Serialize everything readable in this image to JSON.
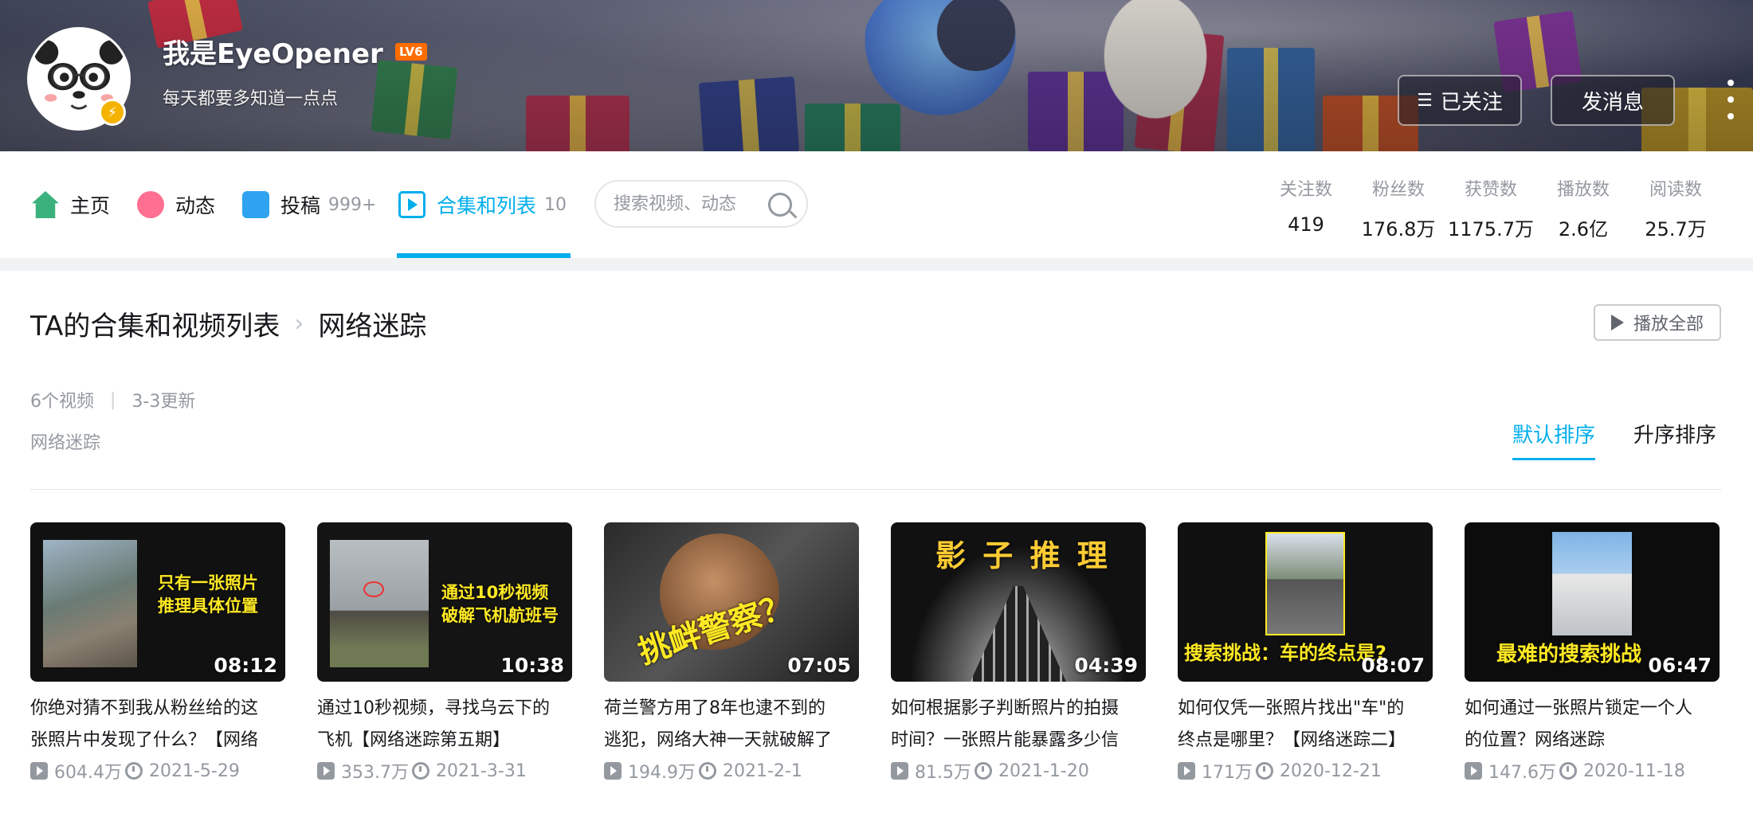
{
  "header": {
    "username": "我是EyeOpener",
    "level": "LV6",
    "signature": "每天都要多知道一点点",
    "follow_button": "已关注",
    "message_button": "发消息"
  },
  "nav": {
    "tabs": [
      {
        "label": "主页",
        "count": ""
      },
      {
        "label": "动态",
        "count": ""
      },
      {
        "label": "投稿",
        "count": "999+"
      },
      {
        "label": "合集和列表",
        "count": "10"
      }
    ],
    "active_tab": "合集和列表",
    "search_placeholder": "搜索视频、动态",
    "stats": [
      {
        "label": "关注数",
        "value": "419"
      },
      {
        "label": "粉丝数",
        "value": "176.8万"
      },
      {
        "label": "获赞数",
        "value": "1175.7万"
      },
      {
        "label": "播放数",
        "value": "2.6亿"
      },
      {
        "label": "阅读数",
        "value": "25.7万"
      }
    ]
  },
  "collection": {
    "breadcrumb_root": "TA的合集和视频列表",
    "breadcrumb_current": "网络迷踪",
    "play_all": "播放全部",
    "video_count": "6个视频",
    "update": "3-3更新",
    "description": "网络迷踪",
    "sort_default": "默认排序",
    "sort_asc": "升序排序"
  },
  "videos": [
    {
      "duration": "08:12",
      "title_line1": "你绝对猜不到我从粉丝给的这",
      "title_line2": "张照片中发现了什么？【网络",
      "views": "604.4万",
      "date": "2021-5-29",
      "caption": "只有一张照片\n推理具体位置"
    },
    {
      "duration": "10:38",
      "title_line1": "通过10秒视频，寻找乌云下的",
      "title_line2": "飞机【网络迷踪第五期】",
      "views": "353.7万",
      "date": "2021-3-31",
      "caption": "通过10秒视频\n破解飞机航班号"
    },
    {
      "duration": "07:05",
      "title_line1": "荷兰警方用了8年也逮不到的",
      "title_line2": "逃犯，网络大神一天就破解了",
      "views": "194.9万",
      "date": "2021-2-1",
      "caption": "挑衅警察？"
    },
    {
      "duration": "04:39",
      "title_line1": "如何根据影子判断照片的拍摄",
      "title_line2": "时间？一张照片能暴露多少信",
      "views": "81.5万",
      "date": "2021-1-20",
      "caption": "影 子 推 理"
    },
    {
      "duration": "08:07",
      "title_line1": "如何仅凭一张照片找出\"车\"的",
      "title_line2": "终点是哪里？【网络迷踪二】",
      "views": "171万",
      "date": "2020-12-21",
      "caption": "搜索挑战：车的终点是?"
    },
    {
      "duration": "06:47",
      "title_line1": "如何通过一张照片锁定一个人",
      "title_line2": "的位置？网络迷踪",
      "views": "147.6万",
      "date": "2020-11-18",
      "caption": "最难的搜索挑战"
    }
  ],
  "colors": {
    "accent": "#00aeec",
    "muted": "#9499a0",
    "level_badge": "#ff6c00"
  }
}
